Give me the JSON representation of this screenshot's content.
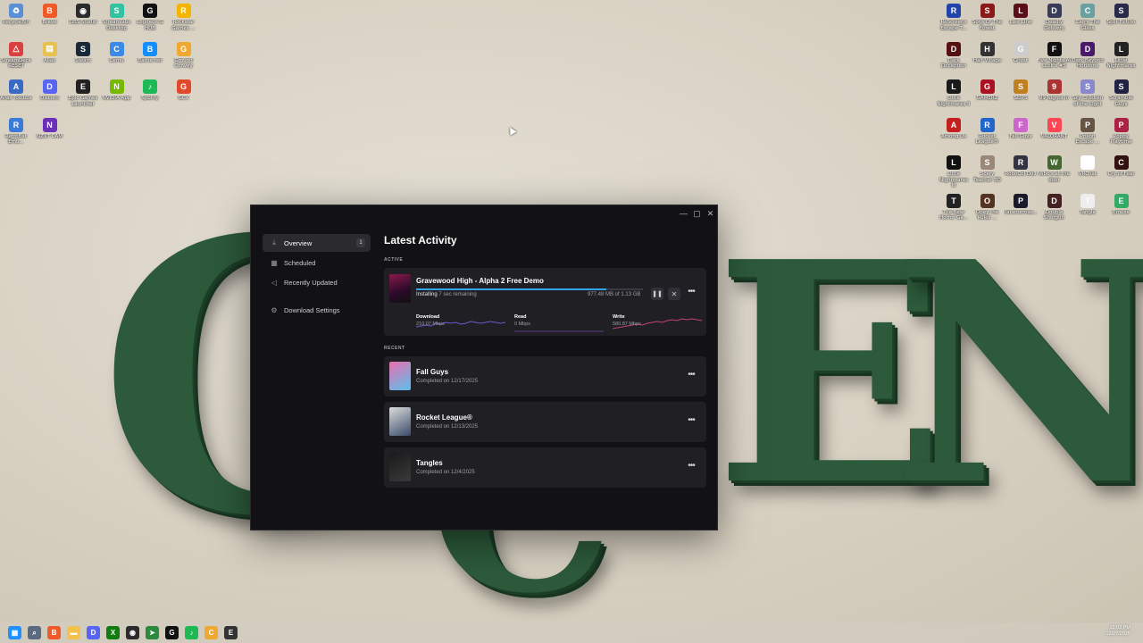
{
  "wallpaper": {
    "letters": [
      "G",
      "C",
      "E",
      "N"
    ]
  },
  "desktop_icons_left": [
    {
      "label": "RecycleBin",
      "color": "#5b8fd6",
      "glyph": "♻"
    },
    {
      "label": "Brave",
      "color": "#f05a28",
      "glyph": "B"
    },
    {
      "label": "OBS Studio",
      "color": "#2b2b2b",
      "glyph": "◉"
    },
    {
      "label": "Streamlabs Desktop",
      "color": "#31c3a2",
      "glyph": "S"
    },
    {
      "label": "Logitech G HUB",
      "color": "#111111",
      "glyph": "G"
    },
    {
      "label": "Rockstar Games ...",
      "color": "#f4b400",
      "glyph": "R"
    },
    {
      "label": "StreamDeck RESET",
      "color": "#d94040",
      "glyph": "△"
    },
    {
      "label": "Alias",
      "color": "#e8c250",
      "glyph": "▤"
    },
    {
      "label": "Steam",
      "color": "#1b2838",
      "glyph": "S"
    },
    {
      "label": "Cemu",
      "color": "#3a8be8",
      "glyph": "C"
    },
    {
      "label": "Battle.net",
      "color": "#148eff",
      "glyph": "B"
    },
    {
      "label": "Ground Convey",
      "color": "#f0a830",
      "glyph": "G"
    },
    {
      "label": "Alias Toolbox",
      "color": "#3a6bc4",
      "glyph": "A"
    },
    {
      "label": "Discord",
      "color": "#5865f2",
      "glyph": "D"
    },
    {
      "label": "Epic Games Launcher",
      "color": "#222222",
      "glyph": "E"
    },
    {
      "label": "NVIDIA App",
      "color": "#76b900",
      "glyph": "N"
    },
    {
      "label": "Spotify",
      "color": "#1db954",
      "glyph": "♪"
    },
    {
      "label": "GCX",
      "color": "#e04a2a",
      "glyph": "G"
    },
    {
      "label": "RetroBat Emu...",
      "color": "#3c7ad8",
      "glyph": "R"
    },
    {
      "label": "NZXT CAM",
      "color": "#6b2fb8",
      "glyph": "N"
    }
  ],
  "desktop_icons_right": [
    {
      "label": "ReScreens Escape T...",
      "color": "#2244aa",
      "glyph": "R"
    },
    {
      "label": "Sons Of The Forest",
      "color": "#8a1a1a",
      "glyph": "S"
    },
    {
      "label": "Last Line",
      "color": "#5a0f18",
      "glyph": "L"
    },
    {
      "label": "Deadly Delivery",
      "color": "#3a3a5a",
      "glyph": "D"
    },
    {
      "label": "Carry The Glass",
      "color": "#6aa0a0",
      "glyph": "C"
    },
    {
      "label": "Split Fiction",
      "color": "#2a2a4a",
      "glyph": "S"
    },
    {
      "label": "Dark Deception",
      "color": "#551111",
      "glyph": "D"
    },
    {
      "label": "Half Village",
      "color": "#333333",
      "glyph": "H"
    },
    {
      "label": "Ghost",
      "color": "#cccccc",
      "glyph": "G"
    },
    {
      "label": "Five Nights At Luck's #5",
      "color": "#111111",
      "glyph": "F"
    },
    {
      "label": "Dark Beyond Horizons",
      "color": "#4a1a6a",
      "glyph": "D"
    },
    {
      "label": "Little Nightmares",
      "color": "#222222",
      "glyph": "L"
    },
    {
      "label": "Little Nightmares II",
      "color": "#1a1a1a",
      "glyph": "L"
    },
    {
      "label": "GAMERZ",
      "color": "#aa1122",
      "glyph": "G"
    },
    {
      "label": "SLIPS",
      "color": "#c08020",
      "glyph": "S"
    },
    {
      "label": "99 Nights In",
      "color": "#aa3333",
      "glyph": "9"
    },
    {
      "label": "Sky Children of the Light",
      "color": "#8888cc",
      "glyph": "S"
    },
    {
      "label": "Scramble Guys",
      "color": "#222244",
      "glyph": "S"
    },
    {
      "label": "Among Us",
      "color": "#c42020",
      "glyph": "A"
    },
    {
      "label": "Rocket League®",
      "color": "#2266cc",
      "glyph": "R"
    },
    {
      "label": "Fall Guys",
      "color": "#cc66cc",
      "glyph": "F"
    },
    {
      "label": "VALORANT",
      "color": "#ff4655",
      "glyph": "V"
    },
    {
      "label": "Prison Escape ...",
      "color": "#665544",
      "glyph": "P"
    },
    {
      "label": "Poppy Playtime",
      "color": "#aa2244",
      "glyph": "P"
    },
    {
      "label": "Little Nightmares III",
      "color": "#111111",
      "glyph": "L"
    },
    {
      "label": "Scary Teacher 3D",
      "color": "#998877",
      "glyph": "S"
    },
    {
      "label": "RoboCol Doll",
      "color": "#333344",
      "glyph": "R"
    },
    {
      "label": "Who's at the door",
      "color": "#446633",
      "glyph": "W"
    },
    {
      "label": "VRChat",
      "color": "#ffffff",
      "glyph": "V"
    },
    {
      "label": "Cry of Fear",
      "color": "#331111",
      "glyph": "C"
    },
    {
      "label": "The Bear Horror Ga...",
      "color": "#222222",
      "glyph": "T"
    },
    {
      "label": "Obey the Rules ...",
      "color": "#553322",
      "glyph": "O"
    },
    {
      "label": "Paranormas...",
      "color": "#1a1a2a",
      "glyph": "P"
    },
    {
      "label": "Double Shotgun",
      "color": "#442222",
      "glyph": "D"
    },
    {
      "label": "Tangle",
      "color": "#eeeeee",
      "glyph": "T"
    },
    {
      "label": "Emuxe",
      "color": "#33aa66",
      "glyph": "E"
    }
  ],
  "window": {
    "controls": {
      "minimize": "—",
      "maximize": "▢",
      "close": "✕"
    },
    "sidebar": {
      "items": [
        {
          "label": "Overview",
          "icon": "download-icon",
          "glyph": "⤓",
          "badge": "1",
          "active": true
        },
        {
          "label": "Scheduled",
          "icon": "calendar-icon",
          "glyph": "▦"
        },
        {
          "label": "Recently Updated",
          "icon": "megaphone-icon",
          "glyph": "◁"
        }
      ],
      "settings": {
        "label": "Download Settings",
        "icon": "gear-icon",
        "glyph": "⚙"
      }
    },
    "main": {
      "title": "Latest Activity",
      "active_label": "ACTIVE",
      "recent_label": "RECENT",
      "active": {
        "name": "Gravewood High - Alpha 2 Free Demo",
        "status": "Installing",
        "remaining": "7 sec remaining",
        "size": "977.48 MB of 1.13 GB",
        "progress": 0.84,
        "stats": [
          {
            "title": "Download",
            "value": "210.07 Mbps",
            "color": "#6a5acd"
          },
          {
            "title": "Read",
            "value": "0 Mbps",
            "color": "#5a3a8a"
          },
          {
            "title": "Write",
            "value": "580.87 Mbps",
            "color": "#c0407a"
          }
        ]
      },
      "recent": [
        {
          "name": "Fall Guys",
          "sub": "Completed on 12/17/2025",
          "colorA": "#e96fb0",
          "colorB": "#5bc0eb"
        },
        {
          "name": "Rocket League®",
          "sub": "Completed on 12/13/2025",
          "colorA": "#dddddd",
          "colorB": "#3a4a6a"
        },
        {
          "name": "Tangles",
          "sub": "Completed on 12/4/2025",
          "colorA": "#1a1a1a",
          "colorB": "#3a3a3a"
        }
      ]
    }
  },
  "taskbar": {
    "icons": [
      {
        "name": "start-button",
        "color": "#1e90ff",
        "glyph": "▦"
      },
      {
        "name": "search-icon",
        "color": "#5a6a80",
        "glyph": "⌕"
      },
      {
        "name": "brave-taskbar-icon",
        "color": "#f05a28",
        "glyph": "B"
      },
      {
        "name": "file-explorer-icon",
        "color": "#f2c14e",
        "glyph": "▬"
      },
      {
        "name": "discord-taskbar-icon",
        "color": "#5865f2",
        "glyph": "D"
      },
      {
        "name": "xbox-taskbar-icon",
        "color": "#107c10",
        "glyph": "X"
      },
      {
        "name": "obs-taskbar-icon",
        "color": "#2b2b2b",
        "glyph": "◉"
      },
      {
        "name": "launcher-taskbar-icon",
        "color": "#2b8a3e",
        "glyph": "➤"
      },
      {
        "name": "logitech-taskbar-icon",
        "color": "#111111",
        "glyph": "G"
      },
      {
        "name": "spotify-taskbar-icon",
        "color": "#1db954",
        "glyph": "♪"
      },
      {
        "name": "crunchy-taskbar-icon",
        "color": "#f0a830",
        "glyph": "C"
      },
      {
        "name": "epic-taskbar-icon",
        "color": "#333333",
        "glyph": "E"
      }
    ],
    "time": "12:03 PM",
    "date": "12/27/2025"
  }
}
